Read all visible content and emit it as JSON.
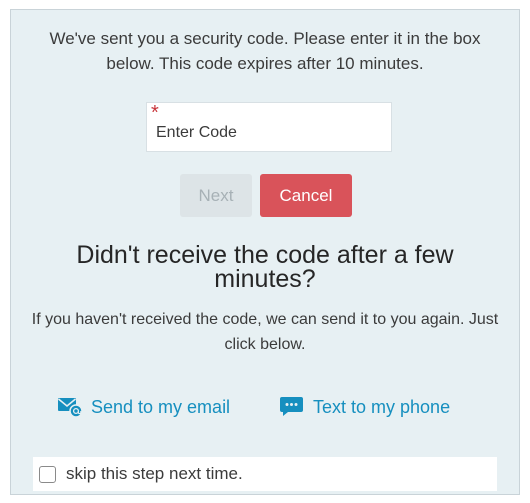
{
  "intro": {
    "text": "We've sent you a security code. Please enter it in the box below. This code expires after 10 minutes."
  },
  "code_input": {
    "required_marker": "*",
    "placeholder": "Enter Code",
    "value": ""
  },
  "buttons": {
    "next_label": "Next",
    "next_disabled": true,
    "cancel_label": "Cancel"
  },
  "resend": {
    "heading": "Didn't receive the code after a few minutes?",
    "text": "If you haven't received the code, we can send it to you again. Just click below.",
    "email_label": "Send to my email",
    "email_icon": "email-icon",
    "phone_label": "Text to my phone",
    "phone_icon": "chat-bubble-icon"
  },
  "skip": {
    "label": "skip this step next time.",
    "checked": false
  },
  "colors": {
    "panel_background": "#e7f0f3",
    "link": "#168fbf",
    "cancel_button": "#d9535a",
    "disabled_button": "#dde4e7",
    "required_marker": "#c8343a"
  }
}
